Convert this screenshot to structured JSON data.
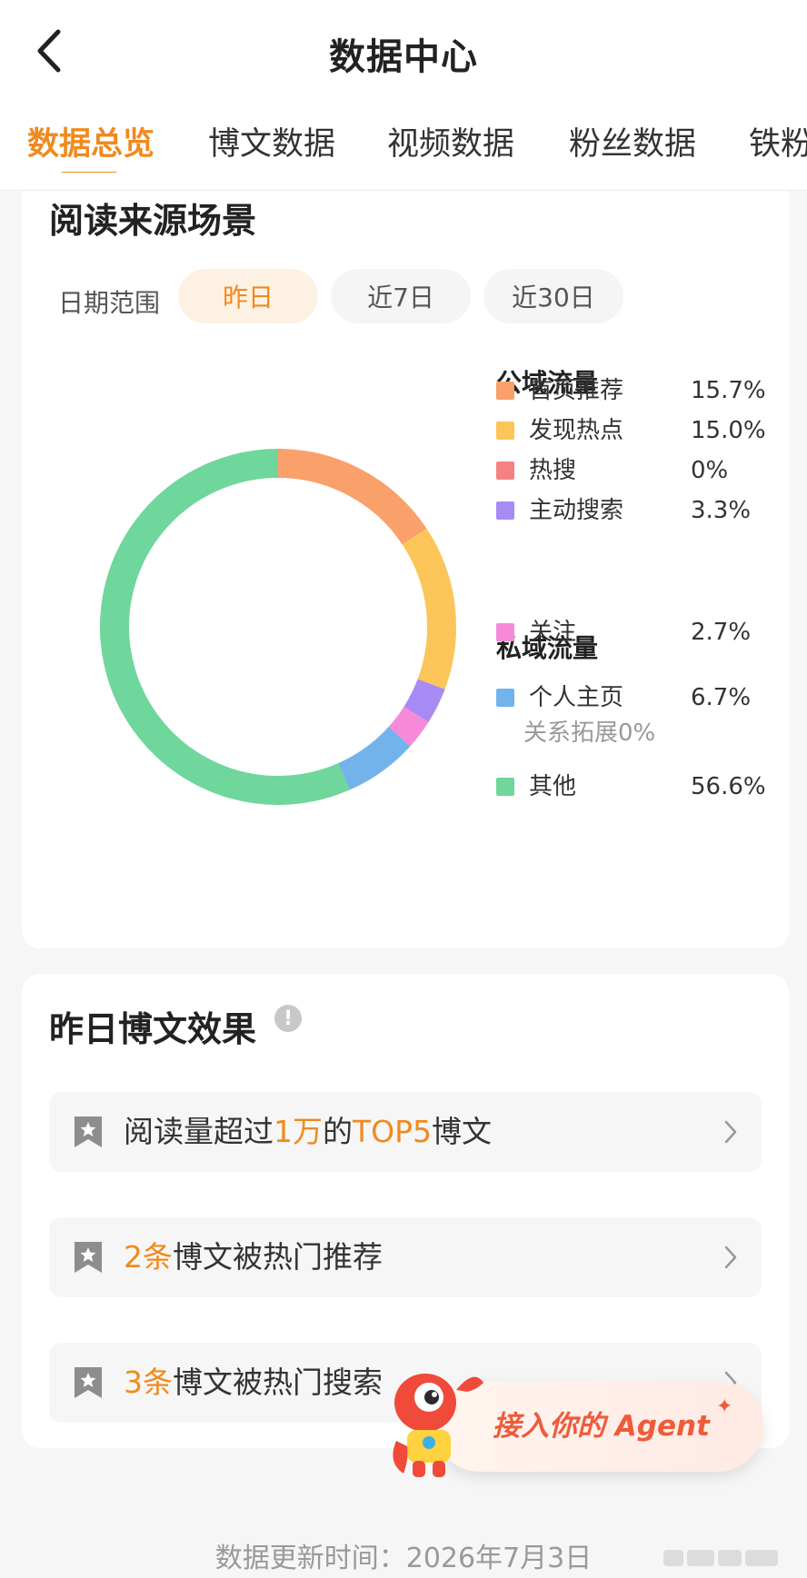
{
  "header": {
    "title": "数据中心"
  },
  "tabs": [
    {
      "label": "数据总览",
      "active": true
    },
    {
      "label": "博文数据",
      "active": false
    },
    {
      "label": "视频数据",
      "active": false
    },
    {
      "label": "粉丝数据",
      "active": false
    },
    {
      "label": "铁粉",
      "active": false
    }
  ],
  "traffic": {
    "title": "阅读来源场景",
    "date_label": "日期范围",
    "date_options": [
      "昨日",
      "近7日",
      "近30日"
    ],
    "selected_date": "昨日",
    "public_title": "公域流量",
    "private_title": "私域流量",
    "relation_note": "关系拓展0%"
  },
  "chart_data": {
    "type": "pie",
    "donut": true,
    "slices": [
      {
        "label": "首页推荐",
        "value": 15.7,
        "display": "15.7%",
        "color": "#f9a06b",
        "group": "公域流量"
      },
      {
        "label": "发现热点",
        "value": 15.0,
        "display": "15.0%",
        "color": "#fbc55a",
        "group": "公域流量"
      },
      {
        "label": "热搜",
        "value": 0,
        "display": "0%",
        "color": "#f48282",
        "group": "公域流量"
      },
      {
        "label": "主动搜索",
        "value": 3.3,
        "display": "3.3%",
        "color": "#a88af5",
        "group": "公域流量"
      },
      {
        "label": "关注",
        "value": 2.7,
        "display": "2.7%",
        "color": "#f78ad8",
        "group": "私域流量"
      },
      {
        "label": "个人主页",
        "value": 6.7,
        "display": "6.7%",
        "color": "#72b3ec",
        "group": "私域流量"
      },
      {
        "label": "其他",
        "value": 56.6,
        "display": "56.6%",
        "color": "#6fd69c",
        "group": ""
      }
    ]
  },
  "posts": {
    "title": "昨日博文效果",
    "info_icon": "!",
    "rows": [
      {
        "parts": [
          [
            "阅读量超过",
            false
          ],
          [
            "1万",
            true
          ],
          [
            "的",
            false
          ],
          [
            "TOP5",
            true
          ],
          [
            "博文",
            false
          ]
        ]
      },
      {
        "parts": [
          [
            "2条",
            true
          ],
          [
            "博文被热门推荐",
            false
          ]
        ]
      },
      {
        "parts": [
          [
            "3条",
            true
          ],
          [
            "博文被热门搜索",
            false
          ]
        ]
      }
    ]
  },
  "agent": {
    "label": "接入你的 Agent",
    "sparkle": "✦"
  },
  "footer": {
    "text": "数据更新时间：2026年7月3日"
  },
  "icons": {
    "back": "chevron-left-icon",
    "bookmark": "bookmark-star-icon",
    "chevron": "chevron-right-icon"
  },
  "colors": {
    "accent": "#f08a1d",
    "agent": "#ee5b3b"
  }
}
